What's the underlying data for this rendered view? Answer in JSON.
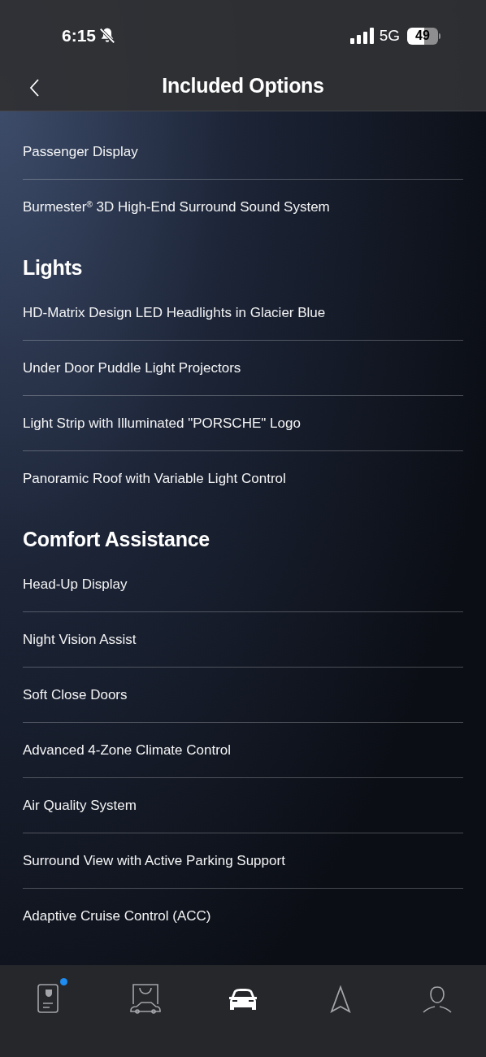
{
  "status_bar": {
    "time": "6:15",
    "silent": true,
    "network": "5G",
    "battery": "49"
  },
  "nav": {
    "title": "Included Options"
  },
  "sections": [
    {
      "items": [
        "Passenger Display",
        "Burmester$^{®}$ 3D High-End Surround Sound System"
      ]
    },
    {
      "title": "Lights",
      "items": [
        "HD-Matrix Design LED Headlights in Glacier Blue",
        "Under Door Puddle Light Projectors",
        "Light Strip with Illuminated \"PORSCHE\" Logo",
        "Panoramic Roof with Variable Light Control"
      ]
    },
    {
      "title": "Comfort Assistance",
      "items": [
        "Head-Up Display",
        "Night Vision Assist",
        "Soft Close Doors",
        "Advanced 4-Zone Climate Control",
        "Air Quality System",
        "Surround View with Active Parking Support",
        "Adaptive Cruise Control (ACC)"
      ]
    }
  ],
  "tab_bar": [
    {
      "kind": "card",
      "selected": false,
      "badge": true
    },
    {
      "kind": "shop",
      "selected": false,
      "badge": false
    },
    {
      "kind": "car",
      "selected": true,
      "badge": false
    },
    {
      "kind": "navigate",
      "selected": false,
      "badge": false
    },
    {
      "kind": "profile",
      "selected": false,
      "badge": false
    }
  ]
}
